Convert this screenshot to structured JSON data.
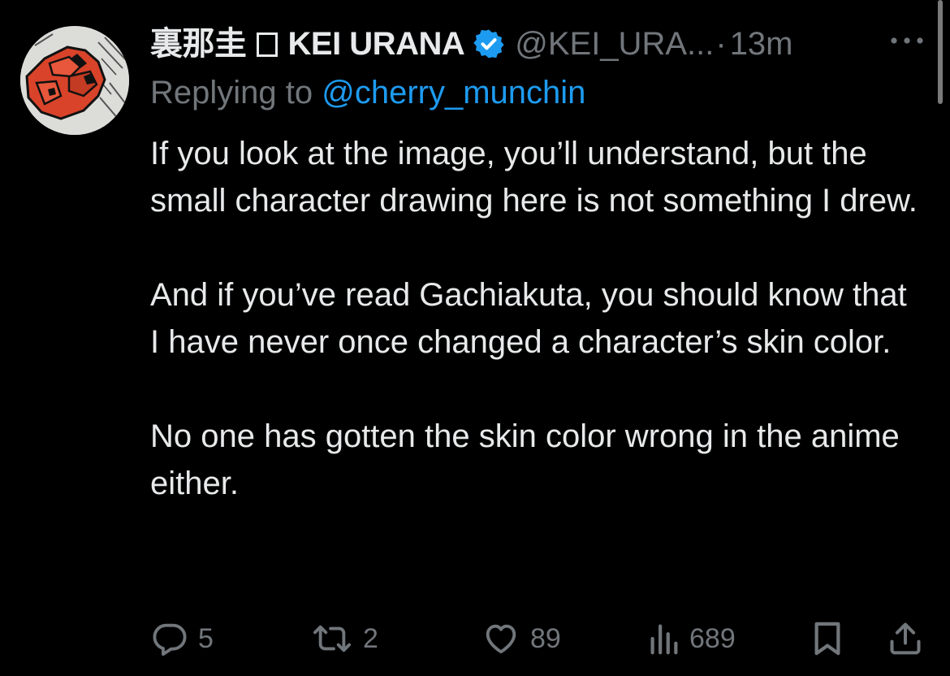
{
  "tweet": {
    "display_name": "裏那圭",
    "display_name_latin": "KEI URANA",
    "handle": "@KEI_URA...",
    "separator": "·",
    "time": "13m",
    "verified": true,
    "replying_prefix": "Replying to",
    "replying_to": "@cherry_munchin",
    "paragraphs": [
      "If you look at the image, you’ll understand, but the small character drawing here is not something I drew.",
      "And if you’ve read Gachiakuta, you should know that I have never once changed a character’s skin color.",
      "No one has gotten the skin color wrong in the anime either."
    ]
  },
  "actions": {
    "replies": "5",
    "retweets": "2",
    "likes": "89",
    "views": "689"
  },
  "icons": {
    "avatar": "avatar-icon",
    "verified": "verified-badge-icon",
    "more": "more-dots-icon",
    "reply": "reply-icon",
    "retweet": "retweet-icon",
    "like": "heart-icon",
    "views": "views-chart-icon",
    "bookmark": "bookmark-icon",
    "share": "share-icon"
  },
  "colors": {
    "background": "#000000",
    "text_primary": "#e7e9ea",
    "text_secondary": "#71767b",
    "link": "#1d9bf0",
    "verified": "#1d9bf0",
    "avatar_red": "#d9432a"
  }
}
